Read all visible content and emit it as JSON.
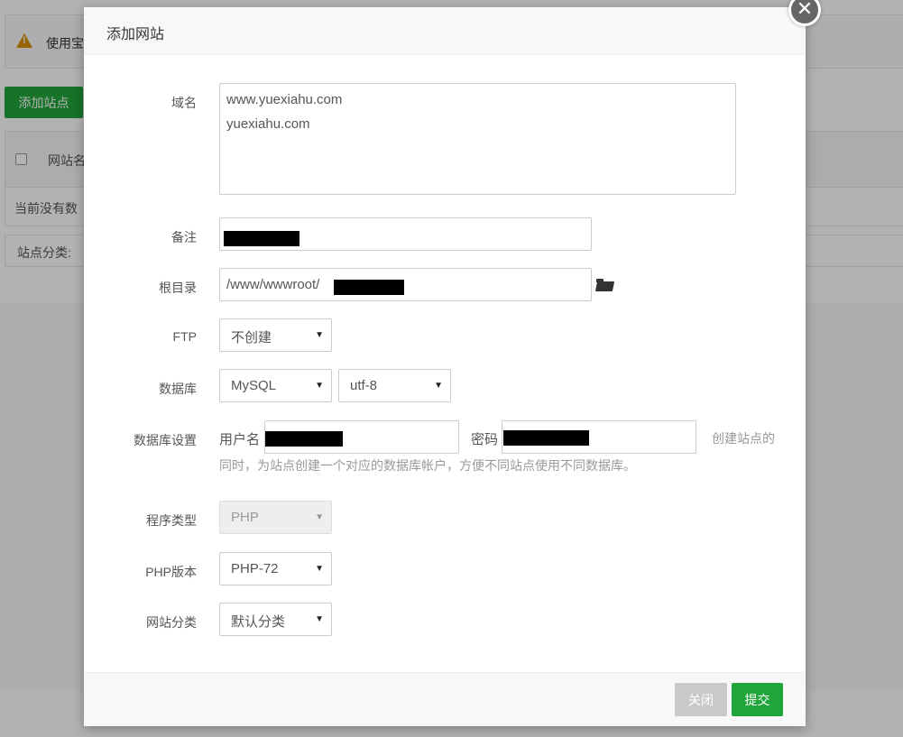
{
  "background": {
    "alert_text": "使用宝",
    "add_site_button": "添加站点",
    "table_header_label": "网站名",
    "empty_text": "当前没有数",
    "category_label": "站点分类:"
  },
  "modal": {
    "title": "添加网站",
    "close_symbol": "✕",
    "domain": {
      "label": "域名",
      "value": "www.yuexiahu.com\nyuexiahu.com"
    },
    "remark": {
      "label": "备注",
      "value": ""
    },
    "root_dir": {
      "label": "根目录",
      "value": "/www/wwwroot/"
    },
    "ftp": {
      "label": "FTP",
      "selected": "不创建"
    },
    "database": {
      "label": "数据库",
      "type_selected": "MySQL",
      "charset_selected": "utf-8"
    },
    "db_settings": {
      "label": "数据库设置",
      "username_label": "用户名",
      "username_value": "",
      "password_label": "密码",
      "password_value": "",
      "hint_line1": "创建站点的",
      "hint_line2": "同时，为站点创建一个对应的数据库帐户，方便不同站点使用不同数据库。"
    },
    "program_type": {
      "label": "程序类型",
      "selected": "PHP"
    },
    "php_version": {
      "label": "PHP版本",
      "selected": "PHP-72"
    },
    "site_category": {
      "label": "网站分类",
      "selected": "默认分类"
    },
    "buttons": {
      "close": "关闭",
      "submit": "提交"
    }
  }
}
